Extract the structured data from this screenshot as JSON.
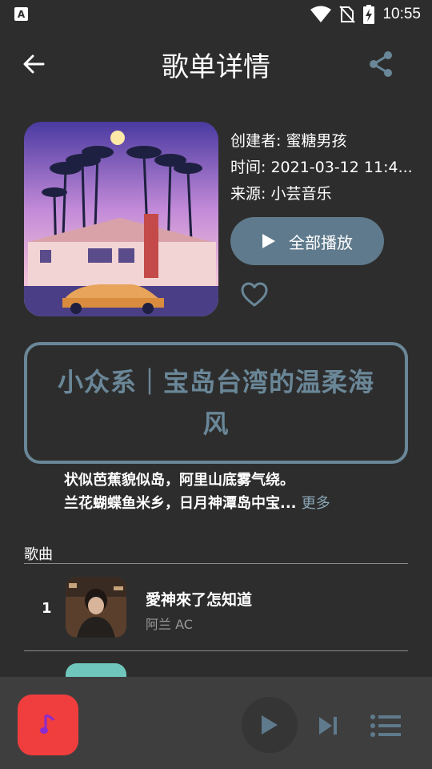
{
  "status_bar": {
    "notification_icon": "a-letter-icon",
    "time": "10:55"
  },
  "app_bar": {
    "title": "歌单详情",
    "back_icon": "arrow-left-icon",
    "share_icon": "share-icon"
  },
  "playlist": {
    "creator_line": "创建者: 蜜糖男孩",
    "time_line": "时间: 2021-03-12 11:4...",
    "source_line": "来源: 小芸音乐",
    "play_all_label": "全部播放",
    "title": "小众系｜宝岛台湾的温柔海风",
    "description_line1": "状似芭蕉貌似岛，阿里山底雾气绕。",
    "description_line2": "兰花蝴蝶鱼米乡，日月神潭岛中宝...",
    "more_label": "更多"
  },
  "songs_section": {
    "label": "歌曲",
    "songs": [
      {
        "index": "1",
        "title": "愛神來了怎知道",
        "artist": "阿兰 AC"
      }
    ]
  },
  "player": {
    "cover_icon": "music-note-icon",
    "play_icon": "play-icon",
    "next_icon": "skip-next-icon",
    "queue_icon": "playlist-queue-icon"
  },
  "colors": {
    "background": "#2d2d2d",
    "accent": "#5f7a8c",
    "title_box": "#6a8798",
    "player_bar": "#3e3e3e",
    "player_cover": "#f03d3d"
  }
}
